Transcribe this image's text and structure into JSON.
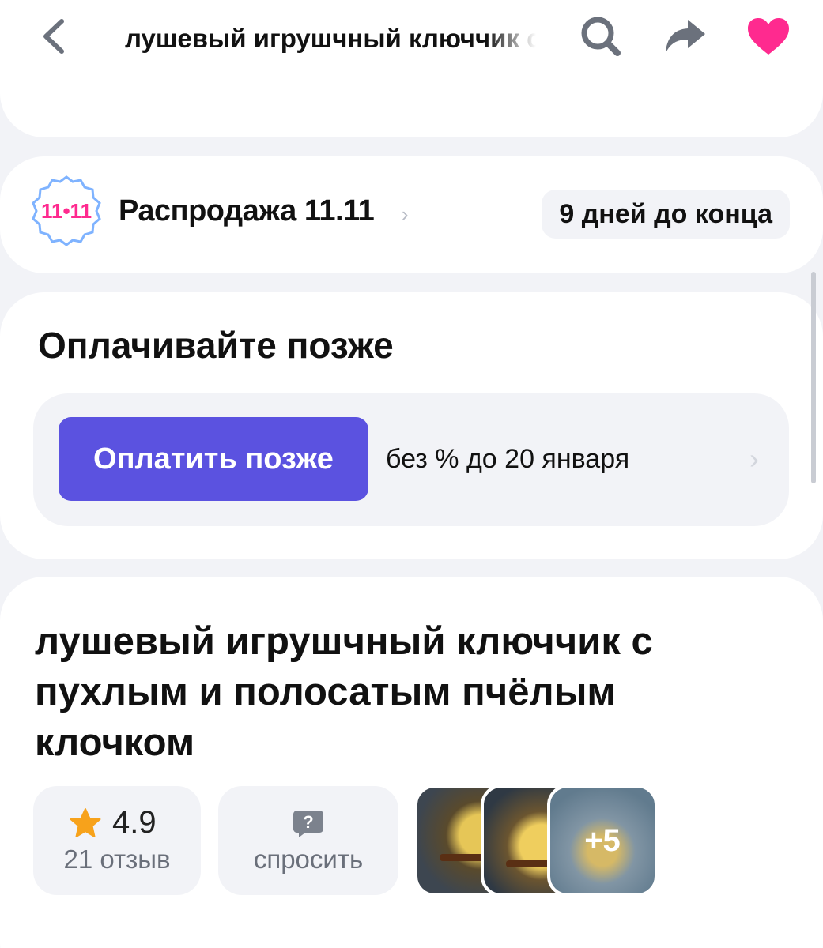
{
  "header": {
    "title": "лушевый игрушчный ключчик с пухлым и полосатым пчёлым клочком",
    "icons": {
      "back": "chevron-left-icon",
      "search": "search-icon",
      "share": "share-arrow-icon",
      "favorite": "heart-icon"
    },
    "favorite_color": "#ff2a8f"
  },
  "sale": {
    "badge_text": "11•11",
    "title": "Распродажа 11.11",
    "chevron": "›",
    "countdown": "9 дней до конца"
  },
  "pay_later": {
    "title": "Оплачивайте позже",
    "button_label": "Оплатить позже",
    "terms": "без % до 20 января",
    "chevron": "›",
    "button_color": "#5b52e0"
  },
  "product": {
    "title": "лушевый игрушчный ключчик с пухлым и полосатым пчёлым клочком",
    "rating": "4.9",
    "reviews": "21 отзыв",
    "ask_label": "спросить",
    "ask_icon": "?",
    "more_photos": "+5",
    "star_color": "#f7a21b"
  }
}
